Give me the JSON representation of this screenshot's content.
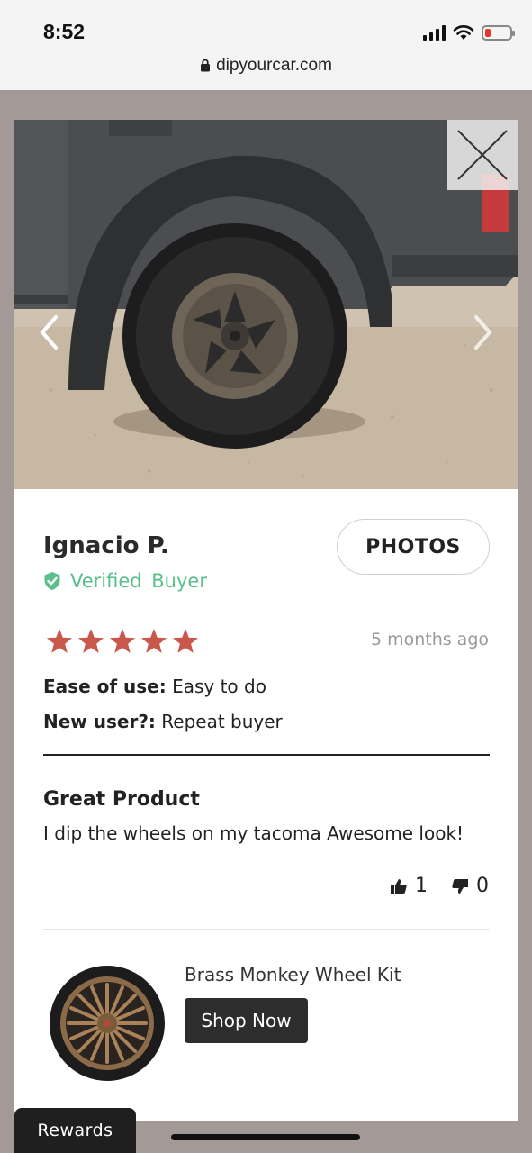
{
  "status_bar": {
    "time": "8:52"
  },
  "browser": {
    "url": "dipyourcar.com"
  },
  "review": {
    "reviewer_name": "Ignacio P.",
    "verified_label": "Verified Buyer",
    "photos_button": "PHOTOS",
    "rating": 5,
    "rating_max": 5,
    "time_ago": "5 months ago",
    "attributes": [
      {
        "label": "Ease of use:",
        "value": "Easy to do"
      },
      {
        "label": "New user?:",
        "value": "Repeat buyer"
      }
    ],
    "title": "Great Product",
    "body": "I dip the wheels on my tacoma Awesome look!",
    "thumbs_up_count": "1",
    "thumbs_down_count": "0"
  },
  "product": {
    "name": "Brass Monkey Wheel Kit",
    "shop_button": "Shop Now"
  },
  "rewards": {
    "label": "Rewards"
  },
  "colors": {
    "star": "#c9574a",
    "verified": "#5bbf8a",
    "shop_button_bg": "#2d2d2d"
  },
  "icons": [
    "lock-icon",
    "signal-icon",
    "wifi-icon",
    "battery-icon",
    "close-icon",
    "chevron-left-icon",
    "chevron-right-icon",
    "verified-shield-icon",
    "star-icon",
    "thumbs-up-icon",
    "thumbs-down-icon"
  ]
}
